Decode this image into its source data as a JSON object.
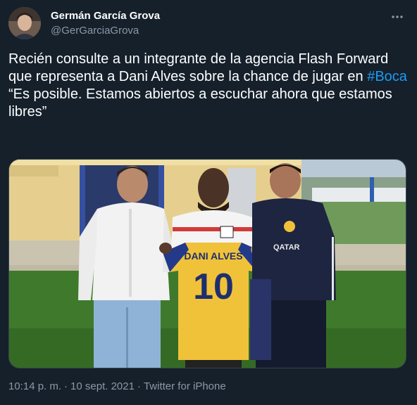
{
  "author": {
    "display_name": "Germán García Grova",
    "handle": "@GerGarciaGrova"
  },
  "tweet": {
    "text_before_hashtag": "Recién consulte a un integrante de la agencia Flash Forward que representa a Dani Alves sobre la chance de jugar en ",
    "hashtag": "#Boca",
    "quote": "“Es posible. Estamos abiertos a escuchar ahora que estamos libres”"
  },
  "photo": {
    "jersey_name": "DANI ALVES",
    "jersey_number": "10"
  },
  "meta": {
    "time": "10:14 p. m.",
    "date": "10 sept. 2021",
    "separator": "·",
    "source": "Twitter for iPhone"
  },
  "colors": {
    "background": "#15202b",
    "link": "#1d9bf0",
    "secondary_text": "#8b98a5"
  },
  "icons": {
    "more": "more-options-icon"
  }
}
